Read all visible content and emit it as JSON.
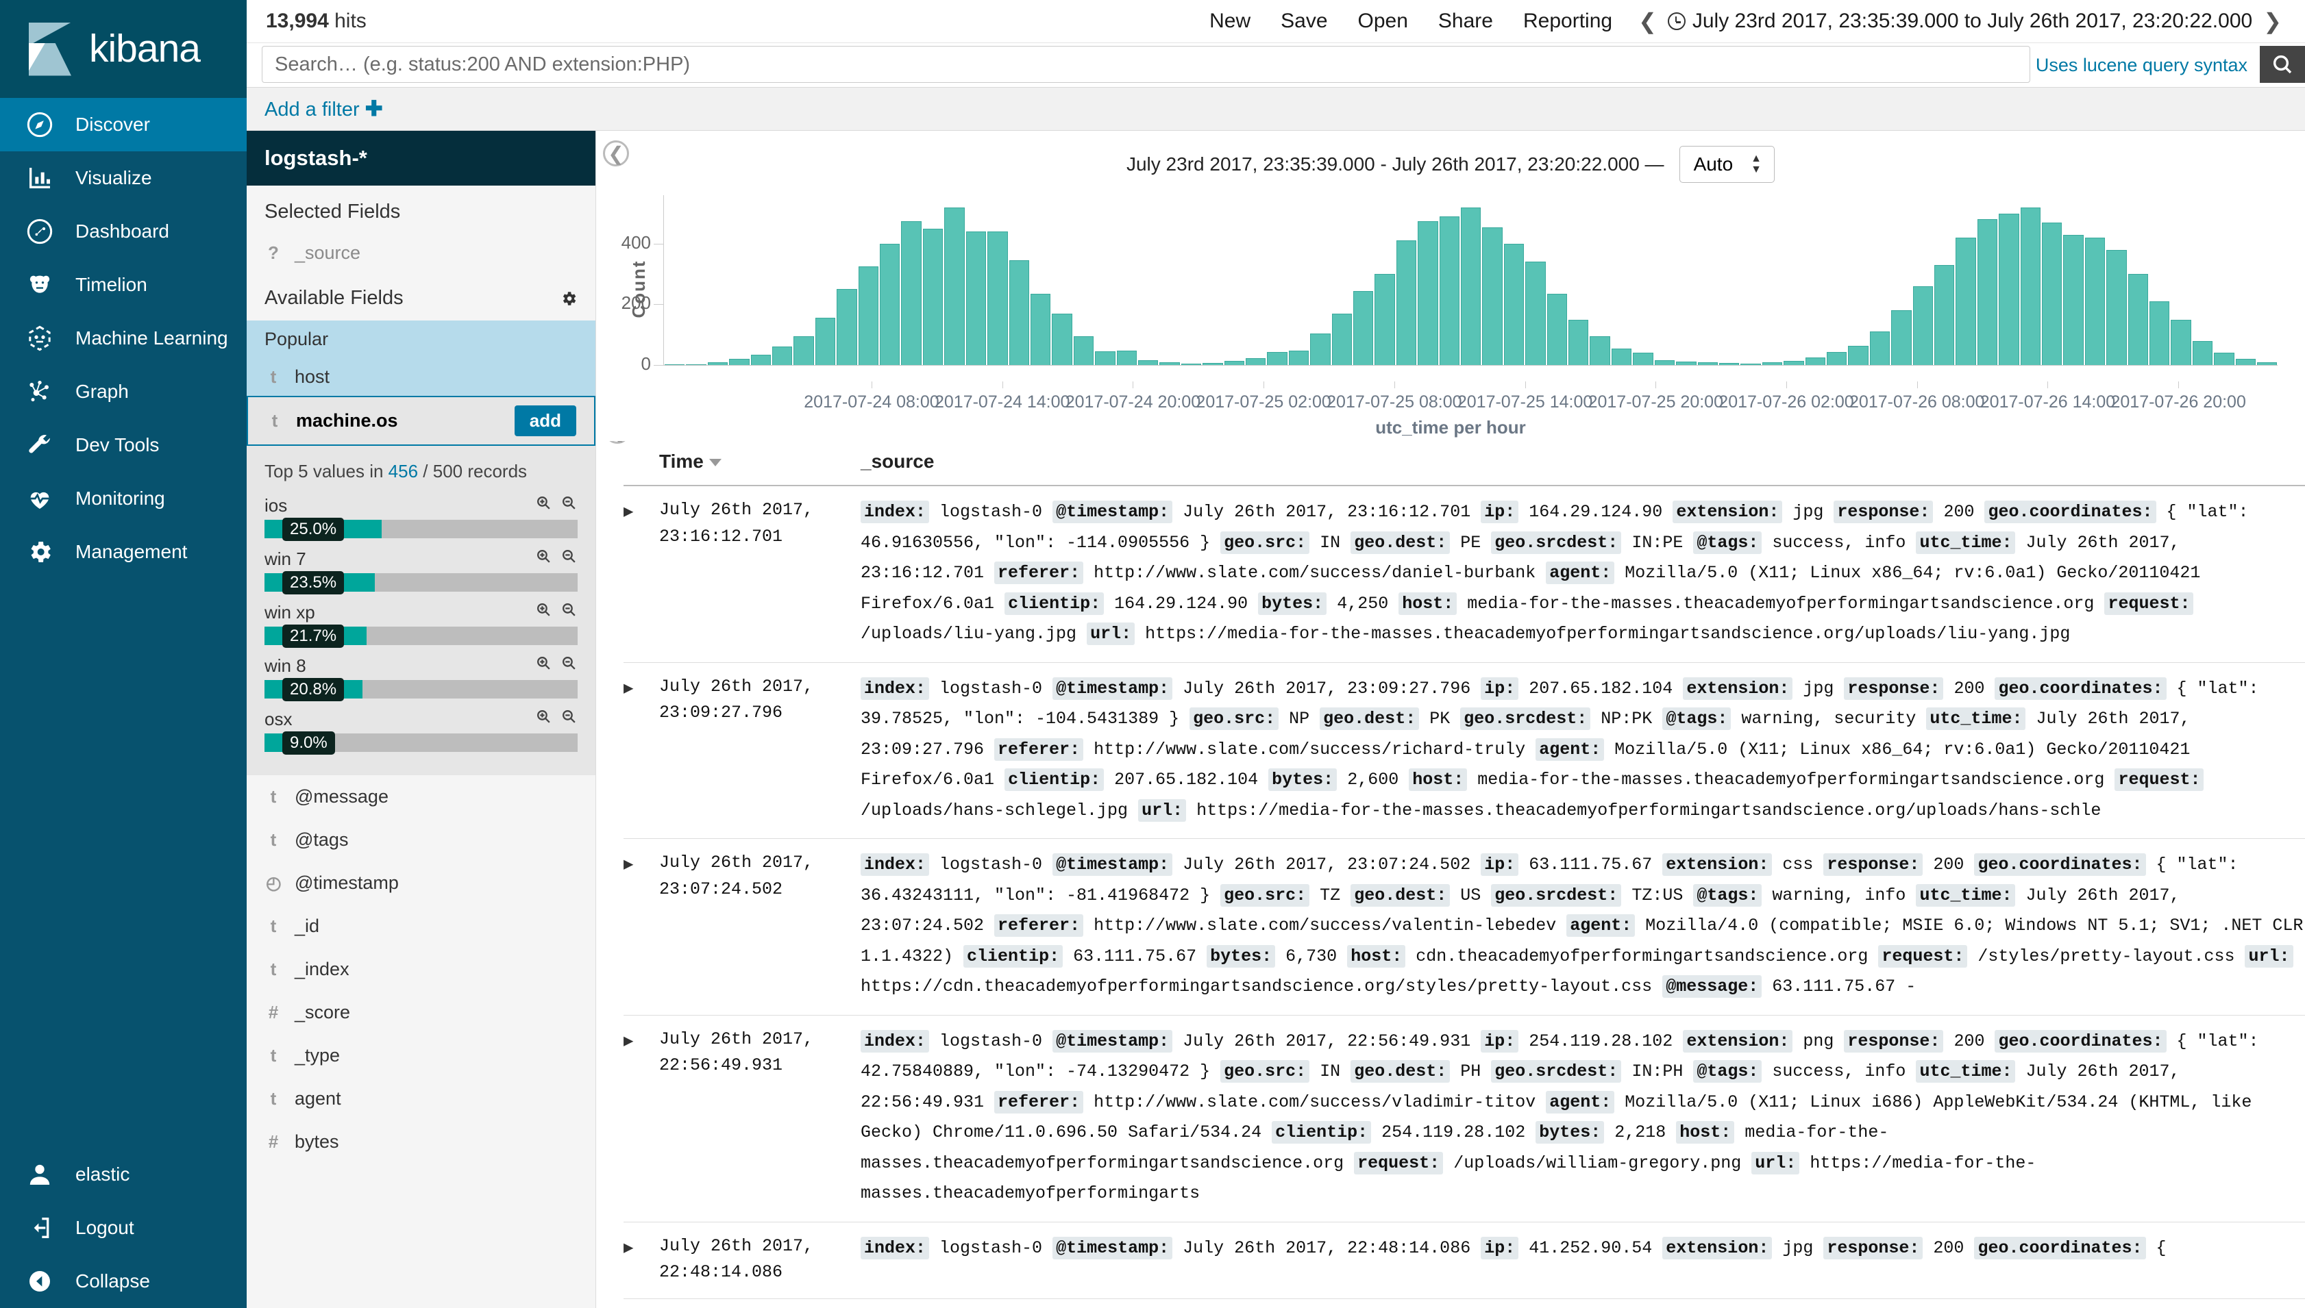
{
  "nav": {
    "brand": "kibana",
    "items": [
      {
        "label": "Discover",
        "icon": "compass-icon",
        "active": true
      },
      {
        "label": "Visualize",
        "icon": "bar-chart-icon",
        "active": false
      },
      {
        "label": "Dashboard",
        "icon": "dashboard-icon",
        "active": false
      },
      {
        "label": "Timelion",
        "icon": "bear-icon",
        "active": false
      },
      {
        "label": "Machine Learning",
        "icon": "ml-icon",
        "active": false
      },
      {
        "label": "Graph",
        "icon": "graph-nodes-icon",
        "active": false
      },
      {
        "label": "Dev Tools",
        "icon": "wrench-icon",
        "active": false
      },
      {
        "label": "Monitoring",
        "icon": "heartbeat-icon",
        "active": false
      },
      {
        "label": "Management",
        "icon": "gear-icon",
        "active": false
      }
    ],
    "bottom": [
      {
        "label": "elastic",
        "icon": "user-icon"
      },
      {
        "label": "Logout",
        "icon": "logout-icon"
      },
      {
        "label": "Collapse",
        "icon": "collapse-left-icon"
      }
    ]
  },
  "topbar": {
    "hits_count": "13,994",
    "hits_label": "hits",
    "menu": [
      "New",
      "Save",
      "Open",
      "Share",
      "Reporting"
    ],
    "prev_arrow": "❮",
    "next_arrow": "❯",
    "time_range": "July 23rd 2017, 23:35:39.000 to July 26th 2017, 23:20:22.000"
  },
  "search": {
    "value": "",
    "placeholder": "Search… (e.g. status:200 AND extension:PHP)",
    "lucene_hint": "Uses lucene query syntax",
    "search_icon": "search-icon"
  },
  "filters": {
    "add_filter_label": "Add a filter",
    "plus": "✚"
  },
  "fields": {
    "index_pattern": "logstash-*",
    "selected_title": "Selected Fields",
    "selected": [
      {
        "type": "?",
        "name": "_source"
      }
    ],
    "available_title": "Available Fields",
    "popular_label": "Popular",
    "popular": [
      {
        "type": "t",
        "name": "host"
      }
    ],
    "active_field": {
      "type": "t",
      "name": "machine.os",
      "add_label": "add"
    },
    "visualization": {
      "summary_prefix": "Top 5 values in ",
      "summary_count": "456",
      "summary_suffix": " / 500 records",
      "buckets": [
        {
          "label": "ios",
          "pct": "25.0%",
          "value": 25.0
        },
        {
          "label": "win 7",
          "pct": "23.5%",
          "value": 23.5
        },
        {
          "label": "win xp",
          "pct": "21.7%",
          "value": 21.7
        },
        {
          "label": "win 8",
          "pct": "20.8%",
          "value": 20.8
        },
        {
          "label": "osx",
          "pct": "9.0%",
          "value": 9.0
        }
      ]
    },
    "rest": [
      {
        "type": "t",
        "name": "@message"
      },
      {
        "type": "t",
        "name": "@tags"
      },
      {
        "type": "◴",
        "name": "@timestamp"
      },
      {
        "type": "t",
        "name": "_id"
      },
      {
        "type": "t",
        "name": "_index"
      },
      {
        "type": "#",
        "name": "_score"
      },
      {
        "type": "t",
        "name": "_type"
      },
      {
        "type": "t",
        "name": "agent"
      },
      {
        "type": "#",
        "name": "bytes"
      }
    ]
  },
  "chart": {
    "title": "July 23rd 2017, 23:35:39.000 - July 26th 2017, 23:20:22.000 —",
    "interval_value": "Auto"
  },
  "chart_data": {
    "type": "bar",
    "title": "July 23rd 2017, 23:35:39.000 - July 26th 2017, 23:20:22.000",
    "xlabel": "utc_time per hour",
    "ylabel": "Count",
    "ylim": [
      0,
      560
    ],
    "yticks": [
      0,
      200,
      400
    ],
    "grid": false,
    "legend": null,
    "xticklabels": [
      "2017-07-24 08:00",
      "2017-07-24 14:00",
      "2017-07-24 20:00",
      "2017-07-25 02:00",
      "2017-07-25 08:00",
      "2017-07-25 14:00",
      "2017-07-25 20:00",
      "2017-07-26 02:00",
      "2017-07-26 08:00",
      "2017-07-26 14:00",
      "2017-07-26 20:00"
    ],
    "xtick_indices": [
      9,
      15,
      21,
      27,
      33,
      39,
      45,
      51,
      57,
      63,
      69
    ],
    "values": [
      2,
      3,
      8,
      20,
      35,
      60,
      95,
      155,
      250,
      325,
      400,
      475,
      450,
      520,
      440,
      440,
      345,
      235,
      170,
      95,
      45,
      48,
      15,
      8,
      4,
      6,
      13,
      22,
      42,
      47,
      105,
      170,
      245,
      300,
      410,
      475,
      490,
      520,
      455,
      400,
      340,
      235,
      150,
      95,
      55,
      40,
      16,
      12,
      10,
      6,
      4,
      8,
      14,
      26,
      44,
      64,
      110,
      180,
      260,
      330,
      420,
      480,
      500,
      520,
      470,
      430,
      420,
      380,
      300,
      210,
      150,
      80,
      40,
      20,
      10
    ]
  },
  "doctable": {
    "columns": [
      "Time",
      "_source"
    ],
    "sort_indicator": "desc",
    "rows": [
      {
        "time": "July 26th 2017, 23:16:12.701",
        "pairs": [
          {
            "k": "index:",
            "v": "logstash-0"
          },
          {
            "k": "@timestamp:",
            "v": "July 26th 2017, 23:16:12.701"
          },
          {
            "k": "ip:",
            "v": "164.29.124.90"
          },
          {
            "k": "extension:",
            "v": "jpg"
          },
          {
            "k": "response:",
            "v": "200"
          },
          {
            "k": "geo.coordinates:",
            "v": "{ \"lat\": 46.91630556, \"lon\": -114.0905556 }"
          },
          {
            "k": "geo.src:",
            "v": "IN"
          },
          {
            "k": "geo.dest:",
            "v": "PE"
          },
          {
            "k": "geo.srcdest:",
            "v": "IN:PE"
          },
          {
            "k": "@tags:",
            "v": "success, info"
          },
          {
            "k": "utc_time:",
            "v": "July 26th 2017, 23:16:12.701"
          },
          {
            "k": "referer:",
            "v": "http://www.slate.com/success/daniel-burbank"
          },
          {
            "k": "agent:",
            "v": "Mozilla/5.0 (X11; Linux x86_64; rv:6.0a1) Gecko/20110421 Firefox/6.0a1"
          },
          {
            "k": "clientip:",
            "v": "164.29.124.90"
          },
          {
            "k": "bytes:",
            "v": "4,250"
          },
          {
            "k": "host:",
            "v": "media-for-the-masses.theacademyofperformingartsandscience.org"
          },
          {
            "k": "request:",
            "v": "/uploads/liu-yang.jpg"
          },
          {
            "k": "url:",
            "v": "https://media-for-the-masses.theacademyofperformingartsandscience.org/uploads/liu-yang.jpg"
          }
        ]
      },
      {
        "time": "July 26th 2017, 23:09:27.796",
        "pairs": [
          {
            "k": "index:",
            "v": "logstash-0"
          },
          {
            "k": "@timestamp:",
            "v": "July 26th 2017, 23:09:27.796"
          },
          {
            "k": "ip:",
            "v": "207.65.182.104"
          },
          {
            "k": "extension:",
            "v": "jpg"
          },
          {
            "k": "response:",
            "v": "200"
          },
          {
            "k": "geo.coordinates:",
            "v": "{ \"lat\": 39.78525, \"lon\": -104.5431389 }"
          },
          {
            "k": "geo.src:",
            "v": "NP"
          },
          {
            "k": "geo.dest:",
            "v": "PK"
          },
          {
            "k": "geo.srcdest:",
            "v": "NP:PK"
          },
          {
            "k": "@tags:",
            "v": "warning, security"
          },
          {
            "k": "utc_time:",
            "v": "July 26th 2017, 23:09:27.796"
          },
          {
            "k": "referer:",
            "v": "http://www.slate.com/success/richard-truly"
          },
          {
            "k": "agent:",
            "v": "Mozilla/5.0 (X11; Linux x86_64; rv:6.0a1) Gecko/20110421 Firefox/6.0a1"
          },
          {
            "k": "clientip:",
            "v": "207.65.182.104"
          },
          {
            "k": "bytes:",
            "v": "2,600"
          },
          {
            "k": "host:",
            "v": "media-for-the-masses.theacademyofperformingartsandscience.org"
          },
          {
            "k": "request:",
            "v": "/uploads/hans-schlegel.jpg"
          },
          {
            "k": "url:",
            "v": "https://media-for-the-masses.theacademyofperformingartsandscience.org/uploads/hans-schle"
          }
        ]
      },
      {
        "time": "July 26th 2017, 23:07:24.502",
        "pairs": [
          {
            "k": "index:",
            "v": "logstash-0"
          },
          {
            "k": "@timestamp:",
            "v": "July 26th 2017, 23:07:24.502"
          },
          {
            "k": "ip:",
            "v": "63.111.75.67"
          },
          {
            "k": "extension:",
            "v": "css"
          },
          {
            "k": "response:",
            "v": "200"
          },
          {
            "k": "geo.coordinates:",
            "v": "{ \"lat\": 36.43243111, \"lon\": -81.41968472 }"
          },
          {
            "k": "geo.src:",
            "v": "TZ"
          },
          {
            "k": "geo.dest:",
            "v": "US"
          },
          {
            "k": "geo.srcdest:",
            "v": "TZ:US"
          },
          {
            "k": "@tags:",
            "v": "warning, info"
          },
          {
            "k": "utc_time:",
            "v": "July 26th 2017, 23:07:24.502"
          },
          {
            "k": "referer:",
            "v": "http://www.slate.com/success/valentin-lebedev"
          },
          {
            "k": "agent:",
            "v": "Mozilla/4.0 (compatible; MSIE 6.0; Windows NT 5.1; SV1; .NET CLR 1.1.4322)"
          },
          {
            "k": "clientip:",
            "v": "63.111.75.67"
          },
          {
            "k": "bytes:",
            "v": "6,730"
          },
          {
            "k": "host:",
            "v": "cdn.theacademyofperformingartsandscience.org"
          },
          {
            "k": "request:",
            "v": "/styles/pretty-layout.css"
          },
          {
            "k": "url:",
            "v": "https://cdn.theacademyofperformingartsandscience.org/styles/pretty-layout.css"
          },
          {
            "k": "@message:",
            "v": "63.111.75.67 -"
          }
        ]
      },
      {
        "time": "July 26th 2017, 22:56:49.931",
        "pairs": [
          {
            "k": "index:",
            "v": "logstash-0"
          },
          {
            "k": "@timestamp:",
            "v": "July 26th 2017, 22:56:49.931"
          },
          {
            "k": "ip:",
            "v": "254.119.28.102"
          },
          {
            "k": "extension:",
            "v": "png"
          },
          {
            "k": "response:",
            "v": "200"
          },
          {
            "k": "geo.coordinates:",
            "v": "{ \"lat\": 42.75840889, \"lon\": -74.13290472 }"
          },
          {
            "k": "geo.src:",
            "v": "IN"
          },
          {
            "k": "geo.dest:",
            "v": "PH"
          },
          {
            "k": "geo.srcdest:",
            "v": "IN:PH"
          },
          {
            "k": "@tags:",
            "v": "success, info"
          },
          {
            "k": "utc_time:",
            "v": "July 26th 2017, 22:56:49.931"
          },
          {
            "k": "referer:",
            "v": "http://www.slate.com/success/vladimir-titov"
          },
          {
            "k": "agent:",
            "v": "Mozilla/5.0 (X11; Linux i686) AppleWebKit/534.24 (KHTML, like Gecko) Chrome/11.0.696.50 Safari/534.24"
          },
          {
            "k": "clientip:",
            "v": "254.119.28.102"
          },
          {
            "k": "bytes:",
            "v": "2,218"
          },
          {
            "k": "host:",
            "v": "media-for-the-masses.theacademyofperformingartsandscience.org"
          },
          {
            "k": "request:",
            "v": "/uploads/william-gregory.png"
          },
          {
            "k": "url:",
            "v": "https://media-for-the-masses.theacademyofperformingarts"
          }
        ]
      },
      {
        "time": "July 26th 2017, 22:48:14.086",
        "pairs": [
          {
            "k": "index:",
            "v": "logstash-0"
          },
          {
            "k": "@timestamp:",
            "v": "July 26th 2017, 22:48:14.086"
          },
          {
            "k": "ip:",
            "v": "41.252.90.54"
          },
          {
            "k": "extension:",
            "v": "jpg"
          },
          {
            "k": "response:",
            "v": "200"
          },
          {
            "k": "geo.coordinates:",
            "v": "{"
          }
        ]
      }
    ]
  }
}
